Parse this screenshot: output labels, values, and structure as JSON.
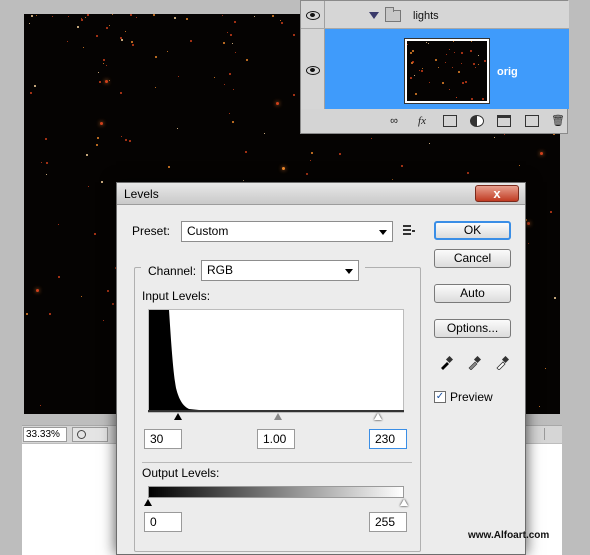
{
  "layers_panel": {
    "layers": [
      {
        "name": "lights",
        "type": "group",
        "visible": true,
        "expanded": true
      },
      {
        "name": "orig",
        "type": "pixel",
        "visible": true,
        "selected": true
      }
    ],
    "toolbar_icons": [
      "link-icon",
      "fx-icon",
      "mask-icon",
      "adjustment-icon",
      "folder-icon",
      "new-layer-icon",
      "trash-icon"
    ],
    "fx_label": "fx"
  },
  "status_bar": {
    "zoom": "33.33%"
  },
  "levels_dialog": {
    "title": "Levels",
    "close_label": "x",
    "preset_label": "Preset:",
    "preset_value": "Custom",
    "channel_label": "Channel:",
    "channel_value": "RGB",
    "input_levels_label": "Input Levels:",
    "input_black": "30",
    "input_gamma": "1.00",
    "input_white": "230",
    "output_levels_label": "Output Levels:",
    "output_black": "0",
    "output_white": "255",
    "buttons": {
      "ok": "OK",
      "cancel": "Cancel",
      "auto": "Auto",
      "options": "Options..."
    },
    "preview_label": "Preview",
    "preview_checked": true
  },
  "watermark": "www.Alfoart.com",
  "colors": {
    "selected_layer": "#3f9bfb",
    "ok_border": "#3a8ee6",
    "close_button": "#c03b22"
  }
}
